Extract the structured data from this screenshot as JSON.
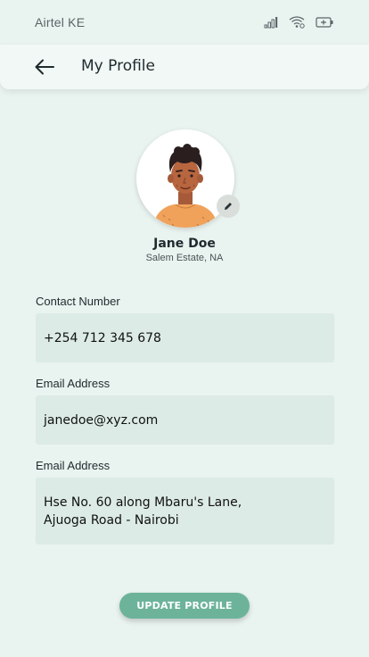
{
  "status_bar": {
    "carrier": "Airtel KE",
    "icons": [
      "signal-icon",
      "wifi-icon",
      "battery-icon"
    ]
  },
  "header": {
    "back_icon": "arrow-left-icon",
    "title": "My Profile"
  },
  "profile": {
    "name": "Jane Doe",
    "location": "Salem Estate, NA",
    "edit_icon": "pencil-icon"
  },
  "form": {
    "contact_label": "Contact Number",
    "contact_value": "+254 712 345 678",
    "email_label": "Email Address",
    "email_value": "janedoe@xyz.com",
    "address_label": "Email Address",
    "address_value": "Hse No. 60 along Mbaru's Lane,\nAjuoga Road - Nairobi"
  },
  "actions": {
    "update_label": "UPDATE PROFILE"
  },
  "colors": {
    "background": "#e9f3ef",
    "field": "#dcebe5",
    "accent": "#6cb39a",
    "avatar_shirt": "#f0a25a"
  }
}
